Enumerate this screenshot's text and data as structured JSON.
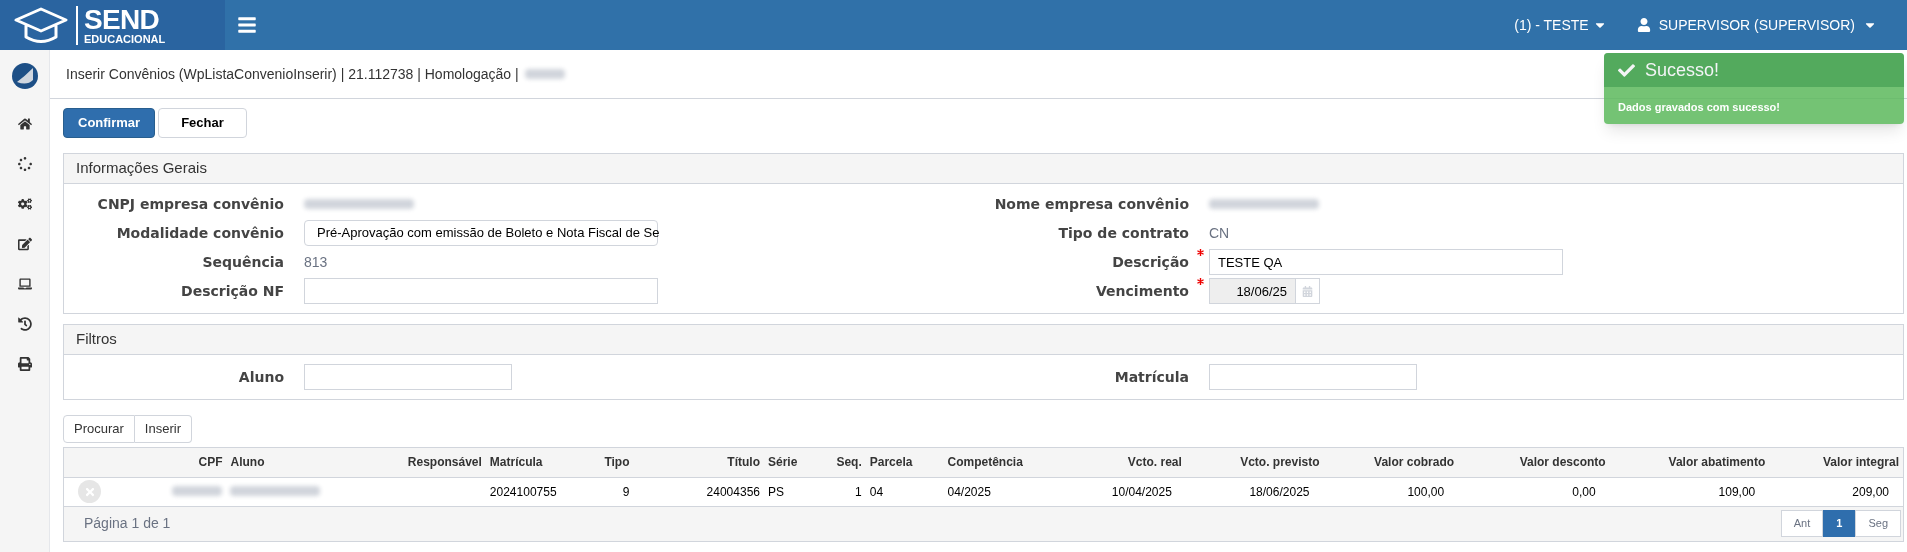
{
  "header": {
    "logo_title": "SEND",
    "logo_subtitle": "EDUCACIONAL",
    "unit": "(1) - TESTE",
    "user": "SUPERVISOR (SUPERVISOR)"
  },
  "toast": {
    "title": "Sucesso!",
    "message": "Dados gravados com sucesso!"
  },
  "breadcrumb": "Inserir Convênios (WpListaConvenioInserir) | 21.112738 | Homologação |",
  "actions": [
    {
      "label": "Confirmar",
      "kind": "primary"
    },
    {
      "label": "Fechar",
      "kind": "default"
    }
  ],
  "general": {
    "title": "Informações Gerais",
    "left_fields": [
      {
        "label": "CNPJ empresa convênio",
        "kind": "redacted",
        "required": false
      },
      {
        "label": "Modalidade convênio",
        "kind": "select",
        "value": "Pré-Aprovação com emissão de Boleto e Nota Fiscal de Se",
        "required": false
      },
      {
        "label": "Sequência",
        "kind": "text",
        "value": "813",
        "required": false
      },
      {
        "label": "Descrição NF",
        "kind": "input",
        "required": false
      }
    ],
    "right_fields": [
      {
        "label": "Nome empresa convênio",
        "kind": "redacted",
        "required": false
      },
      {
        "label": "Tipo de contrato",
        "kind": "text",
        "value": "CN",
        "required": false
      },
      {
        "label": "Descrição",
        "kind": "input",
        "value": "TESTE QA",
        "required": true
      },
      {
        "label": "Vencimento",
        "kind": "date",
        "value": "18/06/25",
        "required": true
      }
    ]
  },
  "filters": {
    "title": "Filtros",
    "left_fields": [
      {
        "label": "Aluno",
        "kind": "short_input",
        "required": false
      }
    ],
    "right_fields": [
      {
        "label": "Matrícula",
        "kind": "short_input",
        "required": false
      }
    ]
  },
  "grid_buttons": [
    "Procurar",
    "Inserir"
  ],
  "table": {
    "columns": [
      "CPF",
      "Aluno",
      "Responsável",
      "Matrícula",
      "Tipo",
      "Título",
      "Série",
      "Seq.",
      "Parcela",
      "Competência",
      "Vcto. real",
      "Vcto. previsto",
      "Valor cobrado",
      "Valor desconto",
      "Valor abatimento",
      "Valor integral"
    ],
    "rows": [
      {
        "cells": [
          null,
          null,
          null,
          "2024100755",
          "9",
          "24004356",
          "PS",
          "1",
          "04",
          "04/2025",
          "10/04/2025",
          "18/06/2025",
          "100,00",
          "0,00",
          "109,00",
          "209,00"
        ]
      }
    ]
  },
  "pagination": {
    "info": "Página 1 de 1",
    "pages": [
      {
        "label": "Ant",
        "selected": false
      },
      {
        "label": "1",
        "selected": true
      },
      {
        "label": "Seg",
        "selected": false
      }
    ]
  }
}
